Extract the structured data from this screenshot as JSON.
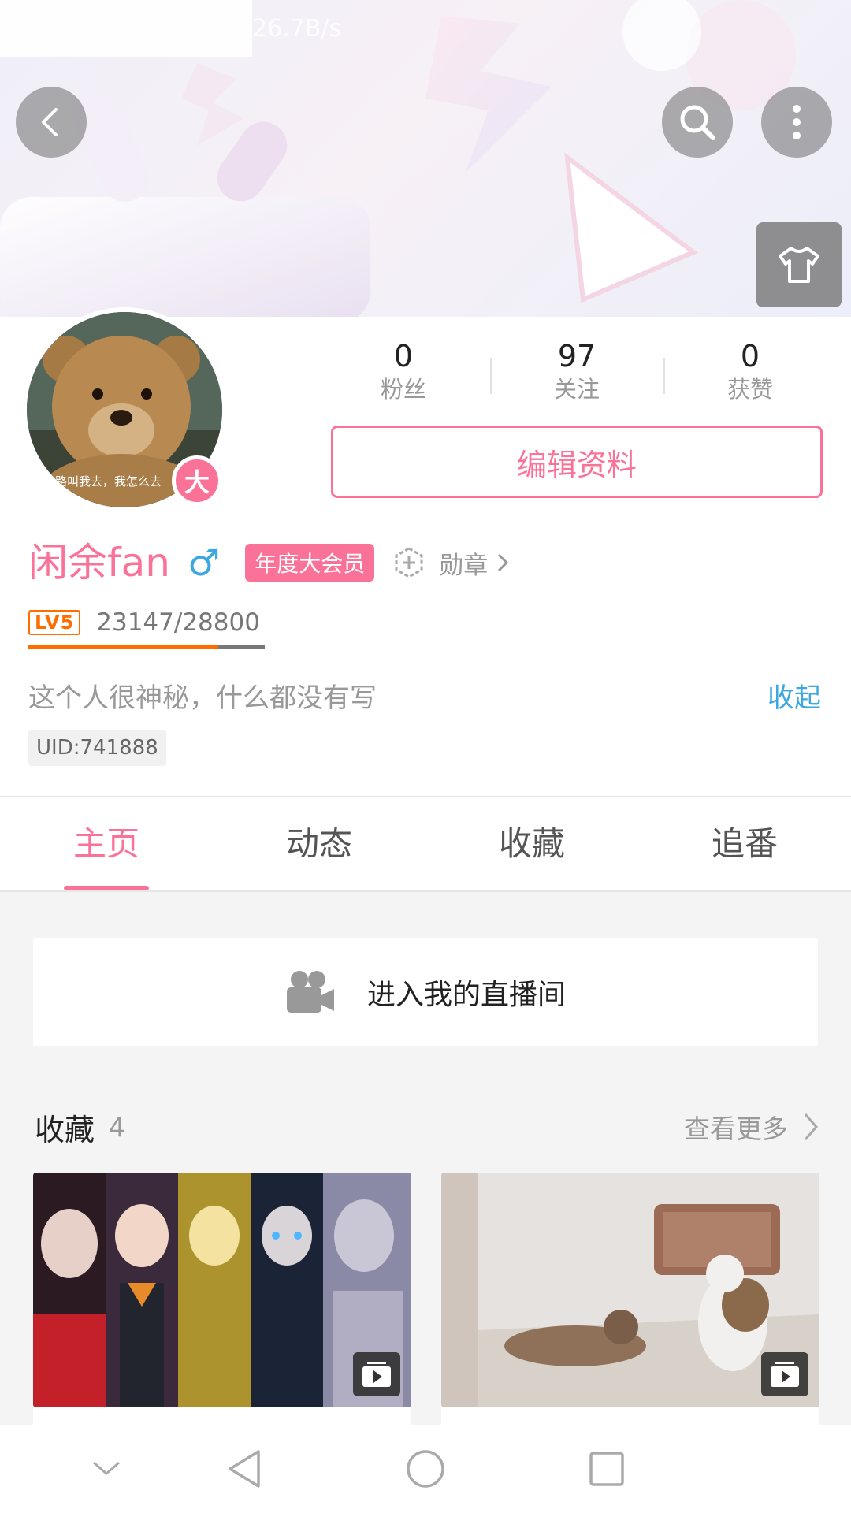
{
  "status_bar": {
    "speed": "26.7B/s"
  },
  "header": {
    "back_icon": "chevron-left-icon",
    "search_icon": "search-icon",
    "more_icon": "vertical-dots-icon",
    "skin_icon": "tshirt-icon"
  },
  "profile": {
    "avatar_caption": "路叫我去，我怎么去",
    "vip_badge": "大",
    "stats": [
      {
        "value": "0",
        "label": "粉丝"
      },
      {
        "value": "97",
        "label": "关注"
      },
      {
        "value": "0",
        "label": "获赞"
      }
    ],
    "edit_label": "编辑资料",
    "name": "闲余fan",
    "gender": "♂",
    "vip_tag": "年度大会员",
    "medal_label": "勋章",
    "level": "LV5",
    "exp_text": "23147/28800",
    "exp_progress": 0.8037,
    "signature": "这个人很神秘，什么都没有写",
    "collapse_label": "收起",
    "uid": "UID:741888"
  },
  "tabs": [
    {
      "label": "主页",
      "active": true
    },
    {
      "label": "动态",
      "active": false
    },
    {
      "label": "收藏",
      "active": false
    },
    {
      "label": "追番",
      "active": false
    }
  ],
  "live": {
    "label": "进入我的直播间"
  },
  "collection": {
    "title": "收藏",
    "count": "4",
    "more_label": "查看更多"
  },
  "colors": {
    "accent": "#fb7299",
    "link": "#3da7e2",
    "level": "#ff6d00"
  }
}
